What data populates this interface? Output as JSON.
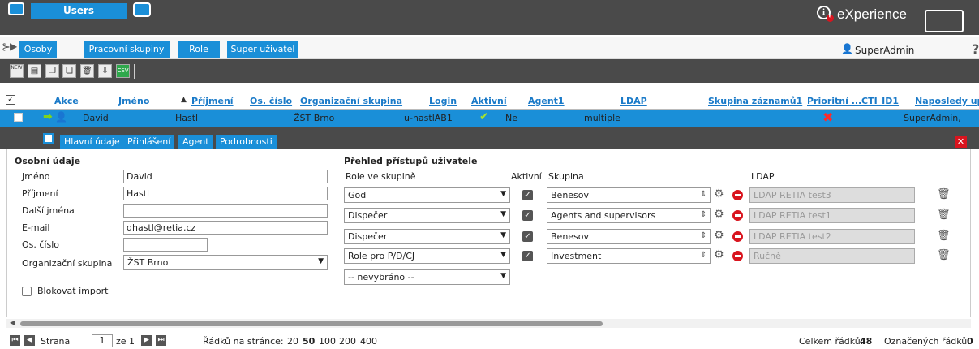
{
  "topbar": {
    "tab_label": "Users",
    "brand": "eXperience",
    "badge": "5"
  },
  "subtabs": [
    "Osoby",
    "Pracovní skupiny",
    "Role",
    "Super uživatel"
  ],
  "user": {
    "name": "SuperAdmin"
  },
  "toolbar": {
    "icons": [
      "new-icon",
      "save-icon",
      "copy-icon",
      "copy-multi-icon",
      "delete-icon",
      "export-icon",
      "csv-icon"
    ],
    "new_label": "NEW",
    "csv_label": "CSV"
  },
  "grid": {
    "columns": [
      "Akce",
      "Jméno",
      "Příjmení",
      "Os. číslo",
      "Organizační skupina",
      "Login",
      "Aktivní",
      "Agent1",
      "LDAP",
      "Skupina záznamů1",
      "Prioritní ...",
      "CTI_ID1",
      "Naposledy upra"
    ],
    "row": {
      "jmeno": "David",
      "prijmeni": "Hastl",
      "org": "ŽST Brno",
      "login": "u-hastlAB1",
      "agent": "Ne",
      "ldap": "multiple",
      "last": "SuperAdmin,"
    }
  },
  "detail_tabs": [
    "Hlavní údaje",
    "Přihlášení",
    "Agent",
    "Podrobnosti"
  ],
  "personal": {
    "heading": "Osobní údaje",
    "fields": [
      {
        "label": "Jméno",
        "value": "David"
      },
      {
        "label": "Příjmení",
        "value": "Hastl"
      },
      {
        "label": "Další jména",
        "value": ""
      },
      {
        "label": "E-mail",
        "value": "dhastl@retia.cz"
      },
      {
        "label": "Os. číslo",
        "value": ""
      },
      {
        "label": "Organizační skupina",
        "value": "ŽST Brno"
      }
    ],
    "block_import": "Blokovat import"
  },
  "access": {
    "heading": "Přehled přístupů uživatele",
    "col_role": "Role ve skupině",
    "col_active": "Aktivní",
    "col_group": "Skupina",
    "col_ldap": "LDAP",
    "rows": [
      {
        "role": "God",
        "group": "Benesov",
        "ldap": "LDAP RETIA test3"
      },
      {
        "role": "Dispečer",
        "group": "Agents and supervisors",
        "ldap": "LDAP RETIA test1"
      },
      {
        "role": "Dispečer",
        "group": "Benesov",
        "ldap": "LDAP RETIA test2"
      },
      {
        "role": "Role pro P/D/CJ",
        "group": "Investment",
        "ldap": "Ručně"
      }
    ],
    "empty_select": "-- nevybráno --"
  },
  "footer": {
    "page_label": "Strana",
    "page_value": "1",
    "of_label": "ze 1",
    "rows_label": "Řádků na stránce:",
    "page_sizes": [
      "20",
      "50",
      "100",
      "200",
      "400"
    ],
    "total_label": "Celkem řádků:",
    "total_value": "48",
    "marked_label": "Označených řádků:",
    "marked_value": "0"
  }
}
